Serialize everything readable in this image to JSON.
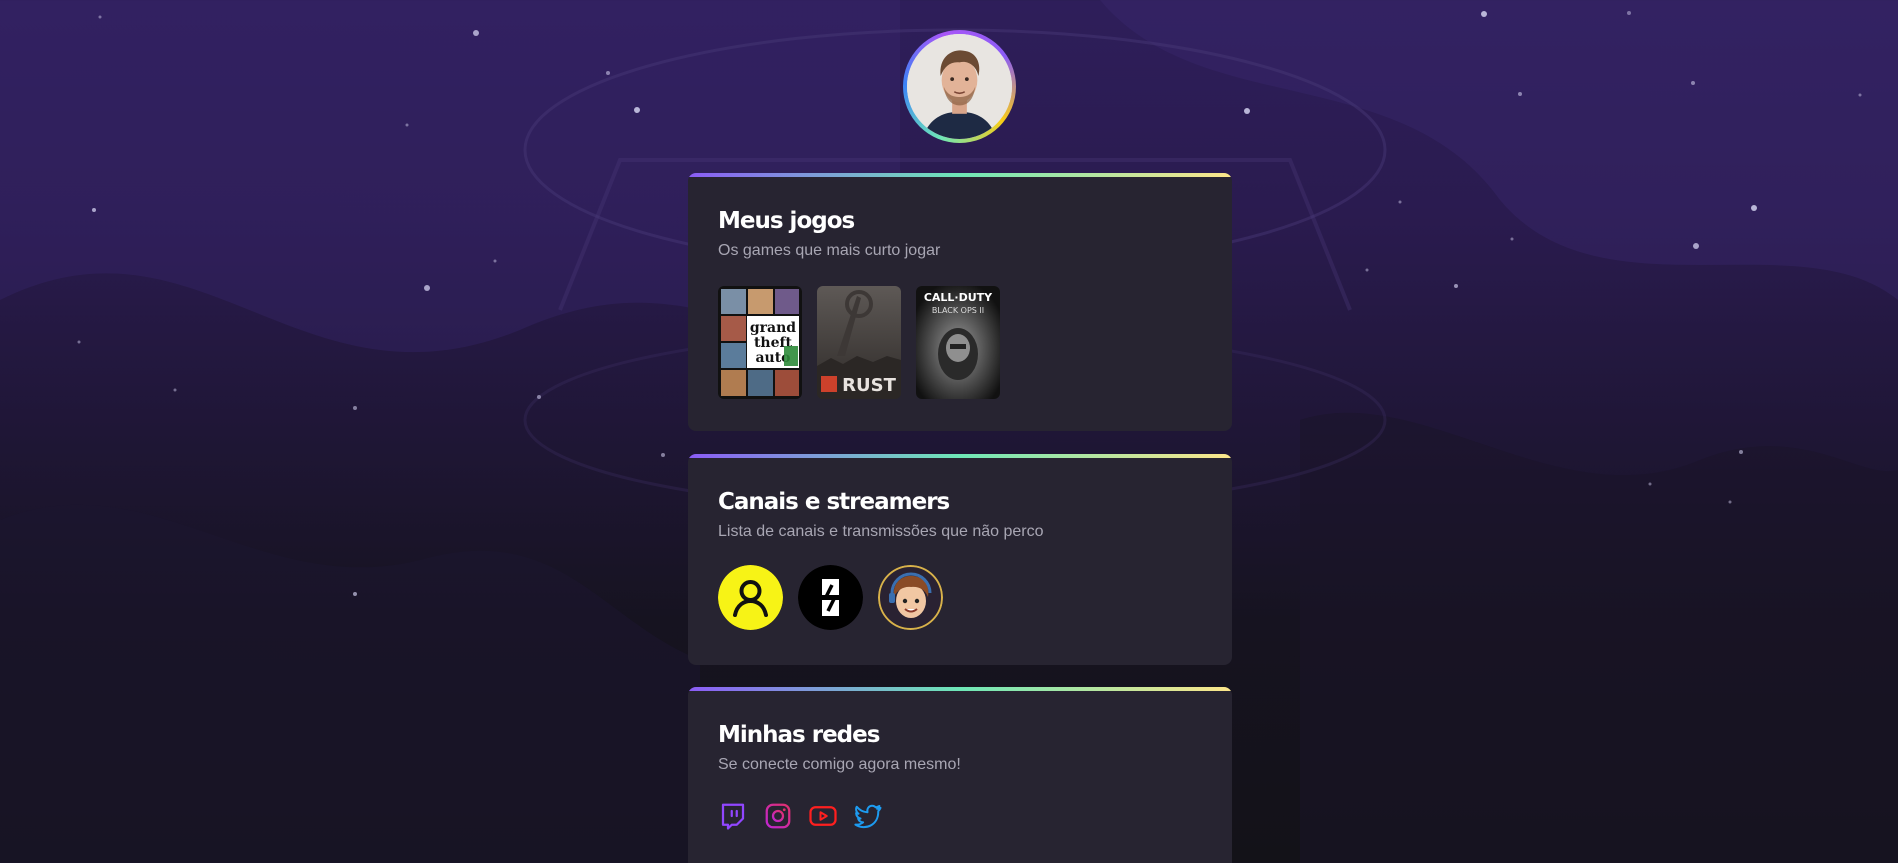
{
  "profile": {
    "avatar_icon": "profile-photo"
  },
  "games_card": {
    "title": "Meus jogos",
    "subtitle": "Os games que mais curto jogar",
    "games": [
      {
        "name": "Grand Theft Auto V",
        "cover_line1": "grand",
        "cover_line2": "theft",
        "cover_line3": "auto"
      },
      {
        "name": "Rust",
        "cover_label": "RUST"
      },
      {
        "name": "Call of Duty Black Ops II",
        "cover_line1": "CALL·DUTY",
        "cover_line2": "BLACK OPS II"
      }
    ]
  },
  "channels_card": {
    "title": "Canais e streamers",
    "subtitle": "Lista de canais e transmissões que não perco",
    "channels": [
      {
        "icon": "user-icon",
        "color": "#f7f316"
      },
      {
        "icon": "channel-logo-icon",
        "color": "#000000"
      },
      {
        "icon": "streamer-avatar-icon",
        "color": "#2a2232"
      }
    ]
  },
  "social_card": {
    "title": "Minhas redes",
    "subtitle": "Se conecte comigo agora mesmo!",
    "links": [
      {
        "icon": "twitch-icon",
        "color": "#9146ff"
      },
      {
        "icon": "instagram-icon",
        "color": "#e1306c"
      },
      {
        "icon": "youtube-icon",
        "color": "#ff0000"
      },
      {
        "icon": "twitter-icon",
        "color": "#1d9bf0"
      }
    ]
  }
}
